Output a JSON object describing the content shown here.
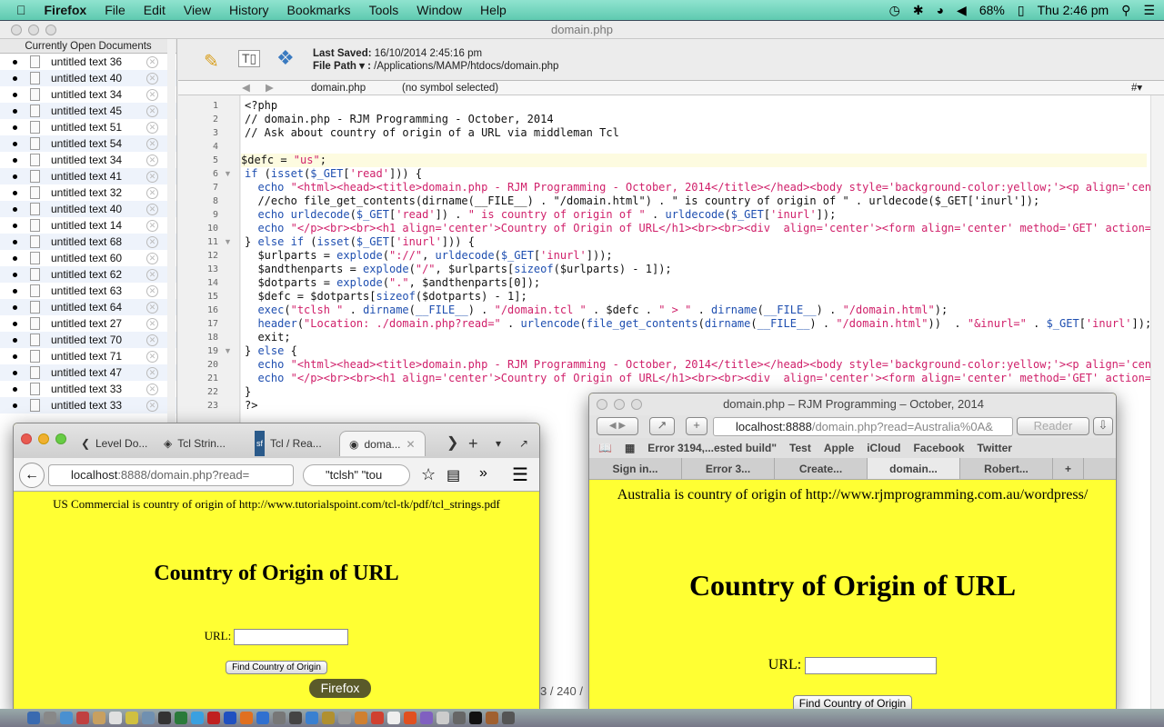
{
  "menubar": {
    "app": "Firefox",
    "items": [
      "File",
      "Edit",
      "View",
      "History",
      "Bookmarks",
      "Tools",
      "Window",
      "Help"
    ],
    "battery": "68%",
    "clock": "Thu 2:46 pm"
  },
  "editor": {
    "title": "domain.php",
    "sidebar_title": "Currently Open Documents",
    "documents": [
      "untitled text 36",
      "untitled text 40",
      "untitled text 34",
      "untitled text 45",
      "untitled text 51",
      "untitled text 54",
      "untitled text 34",
      "untitled text 41",
      "untitled text 32",
      "untitled text 40",
      "untitled text 14",
      "untitled text 68",
      "untitled text 60",
      "untitled text 62",
      "untitled text 63",
      "untitled text 64",
      "untitled text 27",
      "untitled text 70",
      "untitled text 71",
      "untitled text 47",
      "untitled text 33",
      "untitled text 33"
    ],
    "last_saved_label": "Last Saved:",
    "last_saved": "16/10/2014 2:45:16 pm",
    "file_path_label": "File Path ▾ :",
    "file_path": "/Applications/MAMP/htdocs/domain.php",
    "nav_file": "domain.php",
    "nav_symbol": "(no symbol selected)",
    "status": "3 / 240 /",
    "code": [
      "<?php",
      "// domain.php - RJM Programming - October, 2014",
      "// Ask about country of origin of a URL via middleman Tcl",
      "",
      "$defc = \"us\";",
      "if (isset($_GET['read'])) {",
      "  echo \"<html><head><title>domain.php - RJM Programming - October, 2014</title></head><body style='background-color:yellow;'><p align='cen",
      "  //echo file_get_contents(dirname(__FILE__) . \"/domain.html\") . \" is country of origin of \" . urldecode($_GET['inurl']);",
      "  echo urldecode($_GET['read']) . \" is country of origin of \" . urldecode($_GET['inurl']);",
      "  echo \"</p><br><br><h1 align='center'>Country of Origin of URL</h1><br><br><div  align='center'><form align='center' method='GET' action=",
      "} else if (isset($_GET['inurl'])) {",
      "  $urlparts = explode(\"://\", urldecode($_GET['inurl']));",
      "  $andthenparts = explode(\"/\", $urlparts[sizeof($urlparts) - 1]);",
      "  $dotparts = explode(\".\", $andthenparts[0]);",
      "  $defc = $dotparts[sizeof($dotparts) - 1];",
      "  exec(\"tclsh \" . dirname(__FILE__) . \"/domain.tcl \" . $defc . \" > \" . dirname(__FILE__) . \"/domain.html\");",
      "  header(\"Location: ./domain.php?read=\" . urlencode(file_get_contents(dirname(__FILE__) . \"/domain.html\"))  . \"&inurl=\" . $_GET['inurl']);",
      "  exit;",
      "} else {",
      "  echo \"<html><head><title>domain.php - RJM Programming - October, 2014</title></head><body style='background-color:yellow;'><p align='cen",
      "  echo \"</p><br><br><h1 align='center'>Country of Origin of URL</h1><br><br><div  align='center'><form align='center' method='GET' action=",
      "}",
      "?>"
    ]
  },
  "firefox": {
    "tabs": [
      "Level Do...",
      "Tcl Strin...",
      "Tcl / Rea...",
      "doma..."
    ],
    "url_host": "localhost",
    "url_rest": ":8888/domain.php?read=",
    "search": "\"tclsh\" \"tou",
    "result": "US Commercial is country of origin of http://www.tutorialspoint.com/tcl-tk/pdf/tcl_strings.pdf",
    "heading": "Country of Origin of URL",
    "url_label": "URL:",
    "button": "Find Country of Origin"
  },
  "safari": {
    "title": "domain.php – RJM Programming – October, 2014",
    "url_host": "localhost:8888",
    "url_rest": "/domain.php?read=Australia%0A&",
    "reader": "Reader",
    "bookmarks": [
      "Error 3194,...ested build\"",
      "Test",
      "Apple",
      "iCloud",
      "Facebook",
      "Twitter"
    ],
    "tabs": [
      "Sign in...",
      "Error 3...",
      "Create...",
      "domain...",
      "Robert..."
    ],
    "result": "Australia is country of origin of http://www.rjmprogramming.com.au/wordpress/",
    "heading": "Country of Origin of URL",
    "url_label": "URL:",
    "button": "Find Country of Origin"
  },
  "dock": {
    "tooltip": "Firefox"
  }
}
